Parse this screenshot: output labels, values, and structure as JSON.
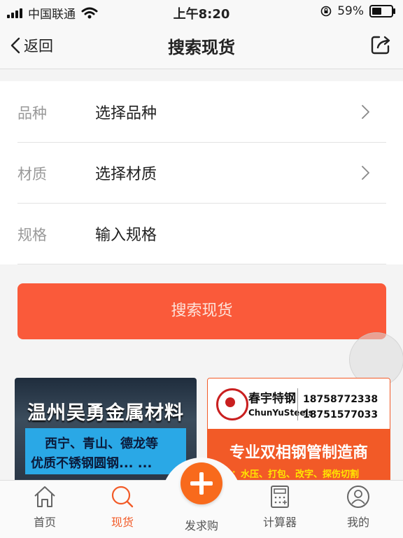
{
  "status_bar": {
    "carrier": "中国联通",
    "time": "上午8:20",
    "battery_percent": "59%",
    "battery_level": 0.59
  },
  "nav": {
    "back_label": "返回",
    "title": "搜索现货"
  },
  "form": {
    "rows": [
      {
        "label": "品种",
        "value": "选择品种"
      },
      {
        "label": "材质",
        "value": "选择材质"
      },
      {
        "label": "规格",
        "value": "输入规格"
      }
    ]
  },
  "search_button": "搜索现货",
  "banners": {
    "left": {
      "title": "温州吴勇金属材料",
      "line1": "西宁、青山、德龙等",
      "line2": "优质不锈钢圆钢... ..."
    },
    "right": {
      "brand": "春宇特钢",
      "brand_en": "ChunYuSteels",
      "phone1": "18758772338",
      "phone2": "18751577033",
      "slogan": "专业双相钢管制造商",
      "service": "服务：水压、打包、改字、探伤切割"
    }
  },
  "tabbar": {
    "tabs": [
      {
        "label": "首页",
        "icon": "home-icon"
      },
      {
        "label": "现货",
        "icon": "search-icon"
      },
      {
        "label": "发求购",
        "icon": "plus-icon"
      },
      {
        "label": "计算器",
        "icon": "calculator-icon"
      },
      {
        "label": "我的",
        "icon": "user-icon"
      }
    ]
  },
  "colors": {
    "accent": "#fa5a3a",
    "active_tab": "#f25a27",
    "fab": "#f86a1c"
  }
}
